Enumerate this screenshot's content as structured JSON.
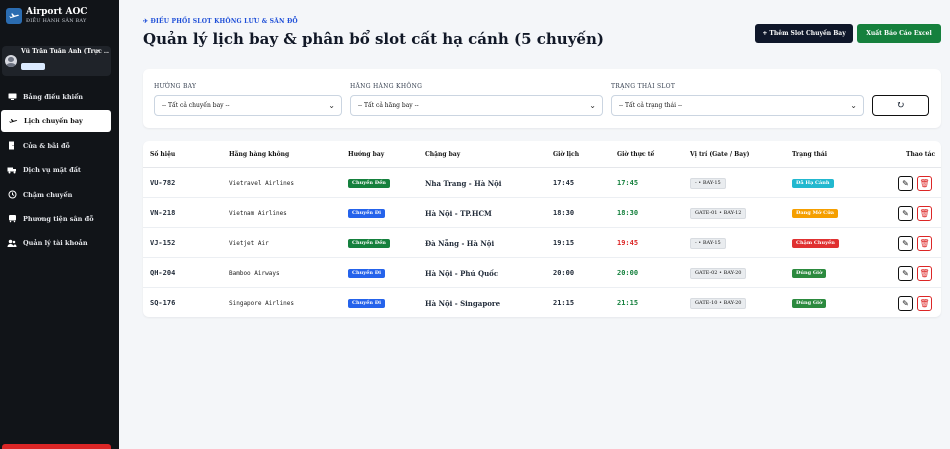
{
  "brand": {
    "title": "Airport AOC",
    "subtitle": "ĐIỀU HÀNH SÂN BAY"
  },
  "user": {
    "name": "Vũ Trần Tuấn Anh (Trực ..."
  },
  "nav": [
    {
      "label": "Bảng điều khiển",
      "icon": "monitor-icon",
      "active": false
    },
    {
      "label": "Lịch chuyến bay",
      "icon": "plane-icon",
      "active": true
    },
    {
      "label": "Cửa & bãi đỗ",
      "icon": "door-icon",
      "active": false
    },
    {
      "label": "Dịch vụ mặt đất",
      "icon": "truck-icon",
      "active": false
    },
    {
      "label": "Chậm chuyến",
      "icon": "clock-icon",
      "active": false
    },
    {
      "label": "Phương tiện sân đỗ",
      "icon": "bus-icon",
      "active": false
    },
    {
      "label": "Quản lý tài khoản",
      "icon": "users-icon",
      "active": false
    }
  ],
  "header": {
    "crumb": "ĐIỀU PHỐI SLOT KHÔNG LƯU & SÂN ĐỖ",
    "title": "Quản lý lịch bay & phân bổ slot cất hạ cánh (5 chuyến)",
    "add_label": "+ Thêm Slot Chuyến Bay",
    "excel_label": "Xuất Báo Cáo Excel"
  },
  "filters": {
    "direction": {
      "label": "HƯỚNG BAY",
      "value": "-- Tất cả chuyến bay --"
    },
    "airline": {
      "label": "HÃNG HÀNG KHÔNG",
      "value": "-- Tất cả hãng bay --"
    },
    "status": {
      "label": "TRẠNG THÁI SLOT",
      "value": "-- Tất cả trạng thái --"
    }
  },
  "table": {
    "headers": [
      "Số hiệu",
      "Hãng hàng không",
      "Hướng bay",
      "Chặng bay",
      "Giờ lịch",
      "Giờ thực tế",
      "Vị trí (Gate / Bay)",
      "Trạng thái",
      "Thao tác"
    ],
    "rows": [
      {
        "code": "VU-782",
        "airline": "Vietravel Airlines",
        "direction": "Chuyến Đến",
        "route": "Nha Trang - Hà Nội",
        "scheduled": "17:45",
        "actual": "17:45",
        "position": "- • BAY-15",
        "status": "Đã Hạ Cánh"
      },
      {
        "code": "VN-218",
        "airline": "Vietnam Airlines",
        "direction": "Chuyến Đi",
        "route": "Hà Nội - TP.HCM",
        "scheduled": "18:30",
        "actual": "18:30",
        "position": "GATE-01 • BAY-12",
        "status": "Đang Mở Cửa"
      },
      {
        "code": "VJ-152",
        "airline": "Vietjet Air",
        "direction": "Chuyến Đến",
        "route": "Đà Nẵng - Hà Nội",
        "scheduled": "19:15",
        "actual": "19:45",
        "position": "- • BAY-15",
        "status": "Chậm Chuyến"
      },
      {
        "code": "QH-204",
        "airline": "Bamboo Airways",
        "direction": "Chuyến Đi",
        "route": "Hà Nội - Phú Quốc",
        "scheduled": "20:00",
        "actual": "20:00",
        "position": "GATE-02 • BAY-20",
        "status": "Đúng Giờ"
      },
      {
        "code": "SQ-176",
        "airline": "Singapore Airlines",
        "direction": "Chuyến Đi",
        "route": "Hà Nội - Singapore",
        "scheduled": "21:15",
        "actual": "21:15",
        "position": "GATE-10 • BAY-20",
        "status": "Đúng Giờ"
      }
    ]
  },
  "colors": {
    "arrive": "#15803d",
    "depart": "#2563eb",
    "actual_ontime": "#15803d",
    "actual_late": "#dc2626",
    "status": {
      "Đã Hạ Cánh": "#22b8cf",
      "Đang Mở Cửa": "#f59f00",
      "Chậm Chuyến": "#e03131",
      "Đúng Giờ": "#2b8a3e"
    }
  }
}
